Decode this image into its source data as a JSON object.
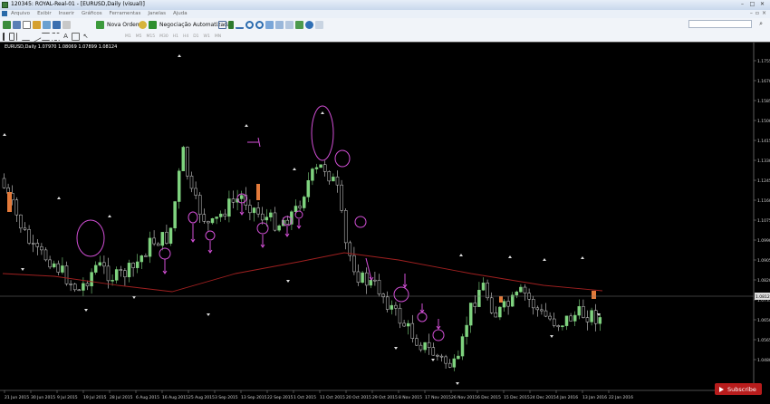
{
  "window": {
    "title": "120345: ROYAL-Real-01 - [EURUSD,Daily (visual)]"
  },
  "menu": [
    "Arquivo",
    "Exibir",
    "Inserir",
    "Gráficos",
    "Ferramentas",
    "Janelas",
    "Ajuda"
  ],
  "toolbar": {
    "new_order": "Nova Ordem",
    "autotrading": "Negociação Automatizada"
  },
  "timeframes": [
    "M1",
    "M5",
    "M15",
    "M30",
    "H1",
    "H4",
    "D1",
    "W1",
    "MN"
  ],
  "chart_info": "EURUSD,Daily  1.07970 1.08069 1.07899 1.08124",
  "current_price": "1.0812",
  "price_ticks": [
    "1.1755",
    "1.1670",
    "1.1585",
    "1.1500",
    "1.1415",
    "1.1330",
    "1.1245",
    "1.1160",
    "1.1075",
    "1.0990",
    "1.0905",
    "1.0820",
    "1.0735",
    "1.0650",
    "1.0565",
    "1.0480"
  ],
  "date_ticks": [
    "21 Jun 2015",
    "30 Jun 2015",
    "9 Jul 2015",
    "19 Jul 2015",
    "28 Jul 2015",
    "6 Aug 2015",
    "16 Aug 2015",
    "25 Aug 2015",
    "3 Sep 2015",
    "13 Sep 2015",
    "22 Sep 2015",
    "1 Oct 2015",
    "11 Oct 2015",
    "20 Oct 2015",
    "29 Oct 2015",
    "8 Nov 2015",
    "17 Nov 2015",
    "26 Nov 2015",
    "6 Dec 2015",
    "15 Dec 2015",
    "24 Dec 2015",
    "4 Jan 2016",
    "13 Jan 2016",
    "22 Jan 2016"
  ],
  "subscribe": "Subscribe",
  "colors": {
    "bull": "#7fd37f",
    "bear": "#d6d6d6",
    "ma": "#a02020",
    "annotation": "#d24fd6",
    "bid_line": "#888888"
  }
}
